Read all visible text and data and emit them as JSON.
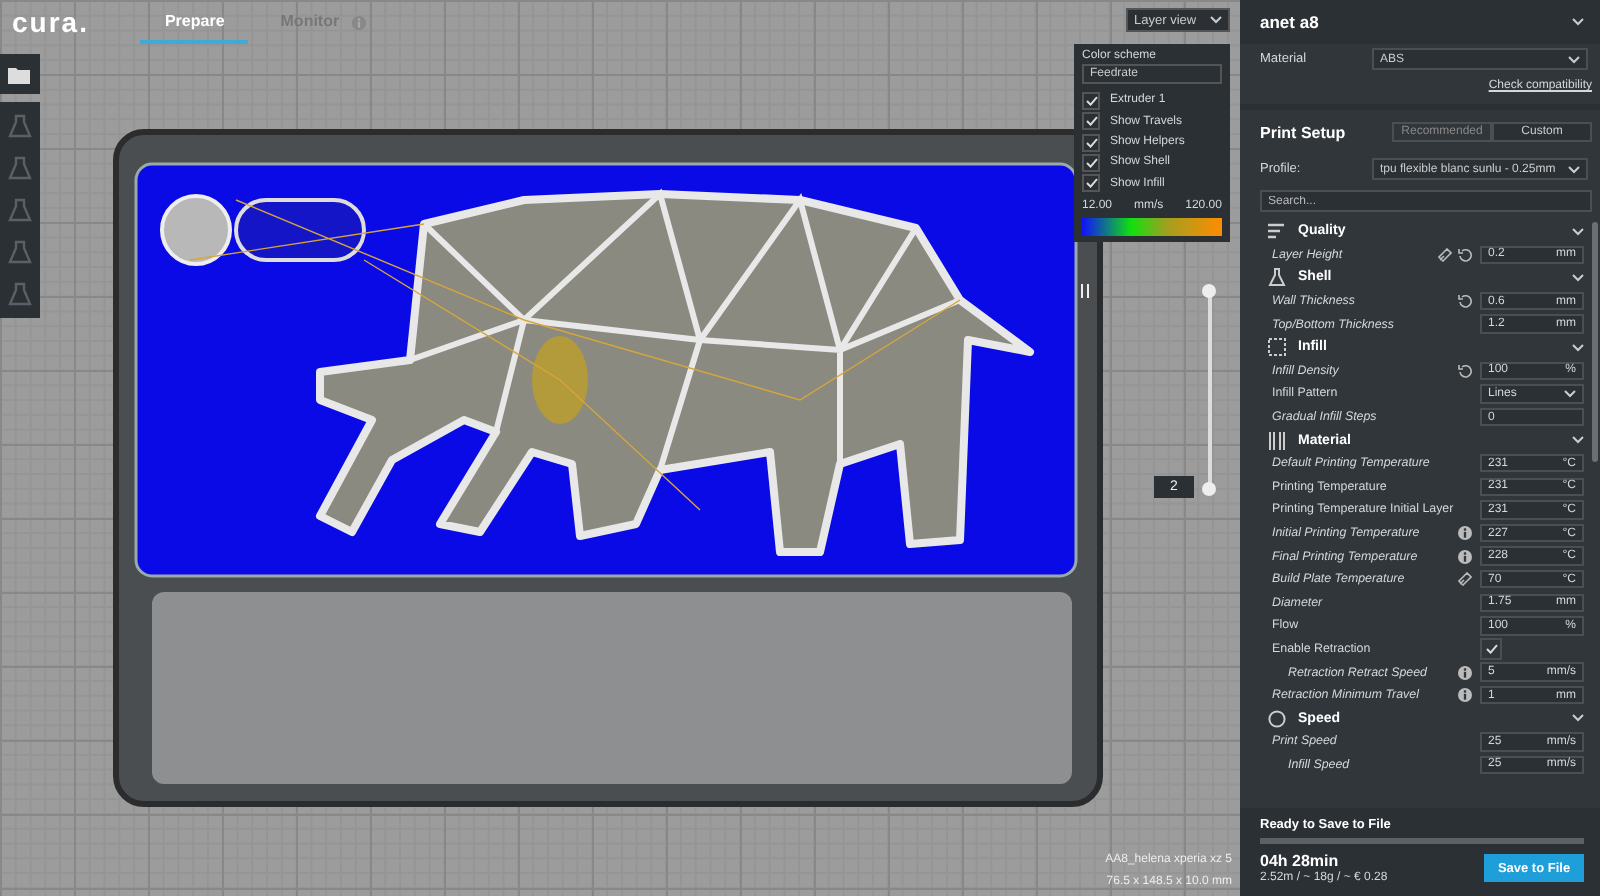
{
  "header": {
    "logo": "cura.",
    "tabs": [
      {
        "label": "Prepare",
        "selected": true
      },
      {
        "label": "Monitor",
        "selected": false
      }
    ]
  },
  "view_mode": {
    "value": "Layer view"
  },
  "layer_panel": {
    "color_scheme_label": "Color scheme",
    "color_scheme": "Feedrate",
    "options": [
      {
        "label": "Extruder 1",
        "checked": true
      },
      {
        "label": "Show Travels",
        "checked": true
      },
      {
        "label": "Show Helpers",
        "checked": true
      },
      {
        "label": "Show Shell",
        "checked": true
      },
      {
        "label": "Show Infill",
        "checked": true
      }
    ],
    "legend_min": "12.00",
    "legend_unit": "mm/s",
    "legend_max": "120.00"
  },
  "layer_slider": {
    "layer": "2"
  },
  "model_info": {
    "name": "AA8_helena xperia xz 5",
    "size": "76.5 x 148.5 x 10.0 mm"
  },
  "printer": {
    "name": "anet a8",
    "material_label": "Material",
    "material": "ABS",
    "compat_link": "Check compatibility"
  },
  "print_setup": {
    "title": "Print Setup",
    "modes": [
      {
        "label": "Recommended",
        "selected": false
      },
      {
        "label": "Custom",
        "selected": true
      }
    ],
    "profile_label": "Profile:",
    "profile": "tpu flexible blanc sunlu - 0.25mm",
    "search_placeholder": "Search..."
  },
  "categories": [
    {
      "label": "Quality",
      "expanded": true,
      "settings": [
        {
          "kind": "field",
          "label": "Layer Height",
          "italic": true,
          "linked": true,
          "resettable": true,
          "value": "0.2",
          "unit": "mm"
        }
      ]
    },
    {
      "label": "Shell",
      "expanded": true,
      "settings": [
        {
          "kind": "field",
          "label": "Wall Thickness",
          "italic": true,
          "resettable": true,
          "value": "0.6",
          "unit": "mm"
        },
        {
          "kind": "field",
          "label": "Top/Bottom Thickness",
          "italic": true,
          "value": "1.2",
          "unit": "mm"
        }
      ]
    },
    {
      "label": "Infill",
      "expanded": true,
      "settings": [
        {
          "kind": "field",
          "label": "Infill Density",
          "italic": true,
          "resettable": true,
          "value": "100",
          "unit": "%"
        },
        {
          "kind": "dropdown",
          "label": "Infill Pattern",
          "italic": false,
          "value": "Lines"
        },
        {
          "kind": "field",
          "label": "Gradual Infill Steps",
          "italic": true,
          "value": "0"
        }
      ]
    },
    {
      "label": "Material",
      "expanded": true,
      "settings": [
        {
          "kind": "field",
          "label": "Default Printing Temperature",
          "italic": true,
          "value": "231",
          "unit": "°C"
        },
        {
          "kind": "field",
          "label": "Printing Temperature",
          "italic": false,
          "value": "231",
          "unit": "°C"
        },
        {
          "kind": "field",
          "label": "Printing Temperature Initial Layer",
          "italic": false,
          "value": "231",
          "unit": "°C"
        },
        {
          "kind": "field",
          "label": "Initial Printing Temperature",
          "italic": true,
          "info": true,
          "value": "227",
          "unit": "°C"
        },
        {
          "kind": "field",
          "label": "Final Printing Temperature",
          "italic": true,
          "info": true,
          "value": "228",
          "unit": "°C"
        },
        {
          "kind": "field",
          "label": "Build Plate Temperature",
          "italic": true,
          "linked": true,
          "value": "70",
          "unit": "°C"
        },
        {
          "kind": "field",
          "label": "Diameter",
          "italic": true,
          "value": "1.75",
          "unit": "mm"
        },
        {
          "kind": "field",
          "label": "Flow",
          "italic": false,
          "value": "100",
          "unit": "%"
        },
        {
          "kind": "checkbox",
          "label": "Enable Retraction",
          "italic": false,
          "checked": true,
          "children": [
            {
              "kind": "field",
              "label": "Retraction Retract Speed",
              "italic": true,
              "info": true,
              "value": "5",
              "unit": "mm/s"
            }
          ]
        },
        {
          "kind": "field",
          "label": "Retraction Minimum Travel",
          "italic": true,
          "info": true,
          "value": "1",
          "unit": "mm"
        }
      ]
    },
    {
      "label": "Speed",
      "expanded": true,
      "settings": [
        {
          "kind": "field",
          "label": "Print Speed",
          "italic": true,
          "value": "25",
          "unit": "mm/s",
          "children": [
            {
              "kind": "field",
              "label": "Infill Speed",
              "italic": true,
              "value": "25",
              "unit": "mm/s"
            }
          ]
        }
      ]
    }
  ],
  "save": {
    "status": "Ready to Save to File",
    "level": 1,
    "time": "04h 28min",
    "estimate": "2.52m / ~ 18g / ~ € 0.28",
    "button": "Save to File"
  }
}
